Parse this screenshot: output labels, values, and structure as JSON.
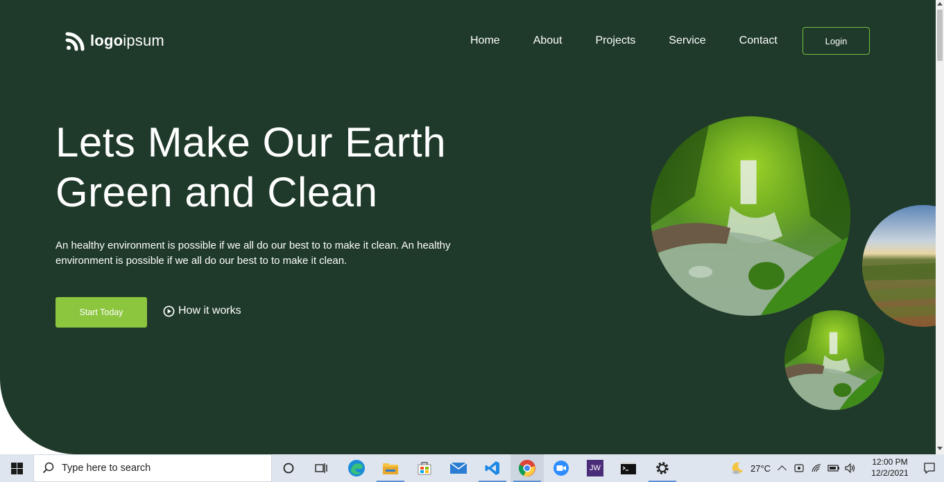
{
  "logo": {
    "bold": "logo",
    "light": "ipsum"
  },
  "nav": [
    {
      "label": "Home"
    },
    {
      "label": "About"
    },
    {
      "label": "Projects"
    },
    {
      "label": "Service"
    },
    {
      "label": "Contact"
    }
  ],
  "login_label": "Login",
  "hero": {
    "headline_line1": "Lets Make Our Earth",
    "headline_line2": "Green and Clean",
    "subtext": "An healthy environment is possible if we all do our best to to make it clean. An healthy environment is possible if we all do our best to to make it clean.",
    "primary_cta": "Start Today",
    "secondary_cta": "How it works"
  },
  "colors": {
    "hero_bg": "#1f3a2a",
    "accent": "#8cc63f",
    "login_border": "#74c043"
  },
  "taskbar": {
    "search_placeholder": "Type here to search",
    "apps": [
      "cortana-icon",
      "task-view-icon",
      "edge-icon",
      "file-explorer-icon",
      "store-icon",
      "mail-icon",
      "vscode-icon",
      "chrome-icon",
      "zoom-icon",
      "jw-icon",
      "terminal-icon",
      "settings-icon"
    ],
    "jw_label": "JW",
    "weather": "27°C",
    "time": "12:00 PM",
    "date": "12/2/2021"
  }
}
